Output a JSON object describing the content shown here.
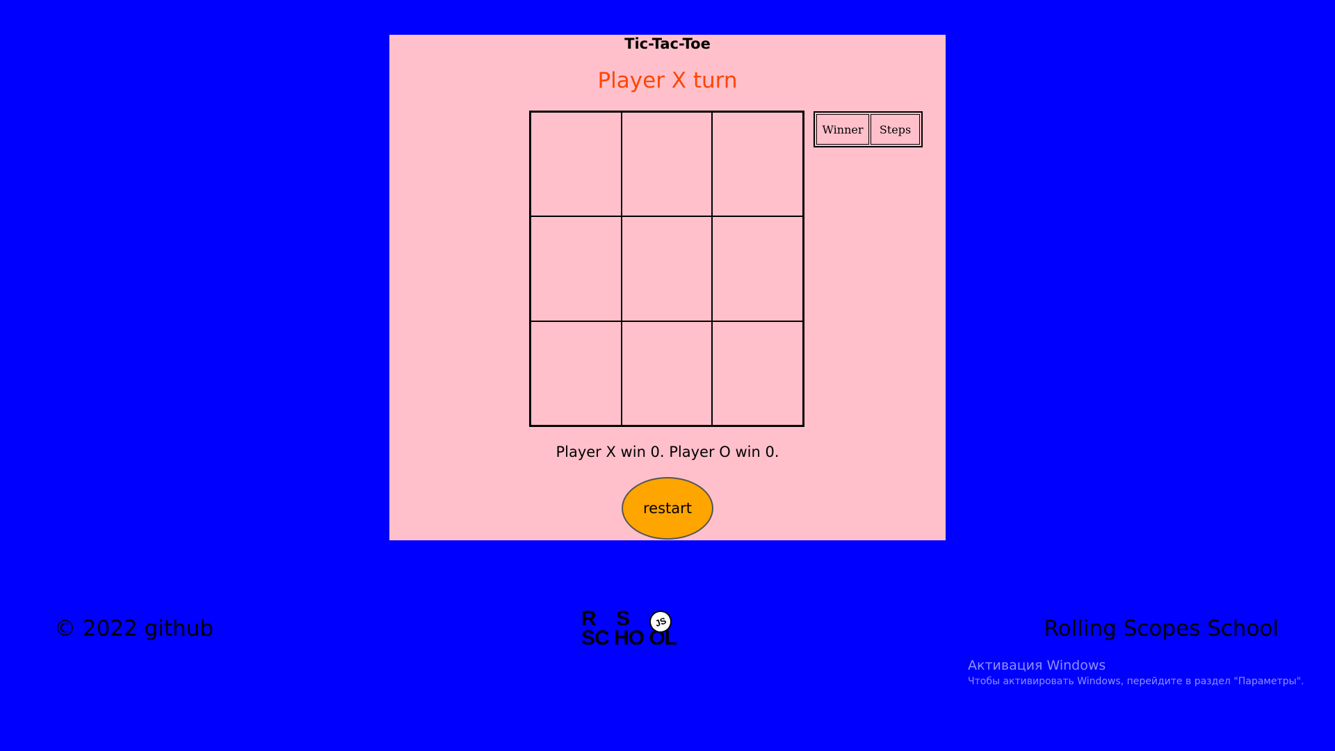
{
  "game": {
    "title": "Tic-Tac-Toe",
    "turn_status": "Player X turn",
    "board": [
      "",
      "",
      "",
      "",
      "",
      "",
      "",
      "",
      ""
    ],
    "results_table": {
      "headers": [
        "Winner",
        "Steps"
      ]
    },
    "score_line": "Player X win 0. Player O win 0.",
    "restart_label": "restart"
  },
  "footer": {
    "copyright": "© 2022 github",
    "school_name": "Rolling Scopes School",
    "logo": {
      "row1": "R    S",
      "row2": "SC HO OL",
      "badge": "JS"
    }
  },
  "watermark": {
    "title": "Активация Windows",
    "subtitle": "Чтобы активировать Windows, перейдите в раздел \"Параметры\"."
  },
  "colors": {
    "page_background": "#0000ff",
    "panel_background": "#ffc0cb",
    "turn_status": "#ff4500",
    "restart_button": "#ffa500"
  }
}
